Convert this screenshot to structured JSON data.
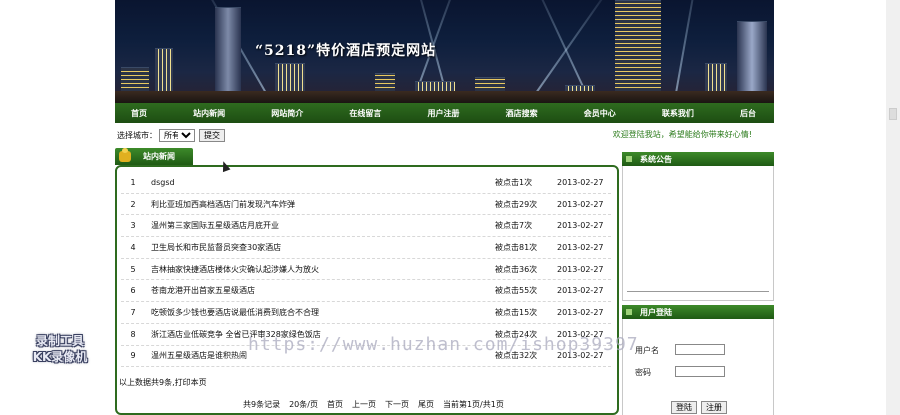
{
  "header": {
    "site_title": "“5218”特价酒店预定网站"
  },
  "nav": {
    "items": [
      {
        "label": "首页"
      },
      {
        "label": "站内新闻"
      },
      {
        "label": "网站简介"
      },
      {
        "label": "在线留言"
      },
      {
        "label": "用户注册"
      },
      {
        "label": "酒店搜索"
      },
      {
        "label": "会员中心"
      },
      {
        "label": "联系我们"
      },
      {
        "label": "后台"
      }
    ]
  },
  "search": {
    "label": "选择城市：",
    "city_selected": "所有",
    "submit_label": "提交",
    "welcome": "欢迎登陆我站，希望能给你带来好心情!"
  },
  "news": {
    "tab_label": "站内新闻",
    "rows": [
      {
        "num": "1",
        "title": "dsgsd",
        "clicks": "被点击1次",
        "date": "2013-02-27"
      },
      {
        "num": "2",
        "title": "利比亚班加西高档酒店门前发现汽车炸弹",
        "clicks": "被点击29次",
        "date": "2013-02-27"
      },
      {
        "num": "3",
        "title": "温州第三家国际五星级酒店月底开业",
        "clicks": "被点击7次",
        "date": "2013-02-27"
      },
      {
        "num": "4",
        "title": "卫生局长和市民监督员突查30家酒店",
        "clicks": "被点击81次",
        "date": "2013-02-27"
      },
      {
        "num": "5",
        "title": "吉林抽家快捷酒店楼体火灾确认起涉嫌人为放火",
        "clicks": "被点击36次",
        "date": "2013-02-27"
      },
      {
        "num": "6",
        "title": "苍南龙港开出首家五星级酒店",
        "clicks": "被点击55次",
        "date": "2013-02-27"
      },
      {
        "num": "7",
        "title": "吃顿饭多少钱也要酒店说最低消费到底合不合理",
        "clicks": "被点击15次",
        "date": "2013-02-27"
      },
      {
        "num": "8",
        "title": "浙江酒店业低碳竞争 全省已评审328家绿色饭店",
        "clicks": "被点击24次",
        "date": "2013-02-27"
      },
      {
        "num": "9",
        "title": "温州五星级酒店是谁积热闹",
        "clicks": "被点击32次",
        "date": "2013-02-27"
      }
    ],
    "summary": "以上数据共9条,打印本页",
    "pager": [
      "共9条记录",
      "20条/页",
      "首页",
      "上一页",
      "下一页",
      "尾页",
      "当前第1页/共1页"
    ]
  },
  "sidebar": {
    "notice_title": "系统公告",
    "login_title": "用户登陆",
    "username_label": "用户名",
    "password_label": "密码",
    "login_button": "登陆",
    "register_button": "注册"
  },
  "watermarks": {
    "url_text": "https://www.huzhan.com/ishop39397",
    "recorder_line1": "录制工具",
    "recorder_line2": "KK录像机"
  },
  "colors": {
    "nav_green": "#1d4d12",
    "accent_green": "#2e6b1f",
    "welcome_text": "#2a7a1a"
  }
}
